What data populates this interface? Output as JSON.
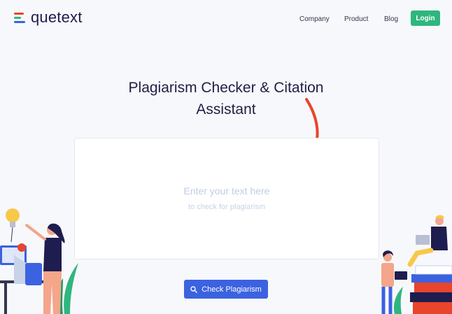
{
  "brand": {
    "name": "quetext"
  },
  "nav": {
    "items": [
      "Company",
      "Product",
      "Blog"
    ],
    "login": "Login"
  },
  "hero": {
    "title_line1": "Plagiarism Checker & Citation",
    "title_line2": "Assistant"
  },
  "editor": {
    "placeholder_line1": "Enter your text here",
    "placeholder_line2": "to check for plagiarism"
  },
  "actions": {
    "check_label": "Check Plagiarism",
    "check_icon": "search-icon"
  },
  "colors": {
    "accent": "#3b62e0",
    "login": "#2fb67e",
    "arrow": "#e8452c",
    "brand_text": "#1e1d4f"
  }
}
